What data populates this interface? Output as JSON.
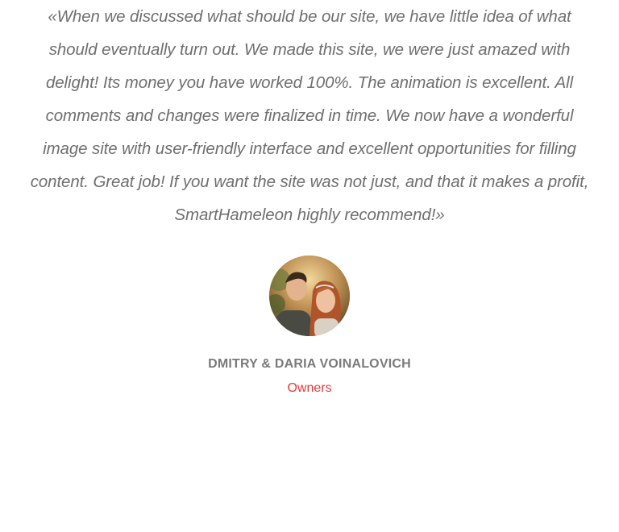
{
  "testimonial": {
    "quote_lines": [
      "«When we discussed what should be our site, we have little idea of what",
      "should eventually turn out. We made this site, we were just amazed with",
      "delight! Its money you have worked 100%. The animation is excellent. All",
      "comments and changes were finalized in time. We now have a wonderful",
      "image site with user-friendly interface and excellent opportunities for filling",
      "content. Great job! If you want the site was not just, and that it makes a profit,",
      "SmartHameleon highly recommend!»"
    ],
    "author_name": "DMITRY & DARIA VOINALOVICH",
    "author_role": "Owners",
    "avatar_icon": "couple-photo",
    "colors": {
      "quote_text": "#6f6f6f",
      "author_name": "#7a7a7a",
      "author_role": "#e8393c"
    }
  }
}
